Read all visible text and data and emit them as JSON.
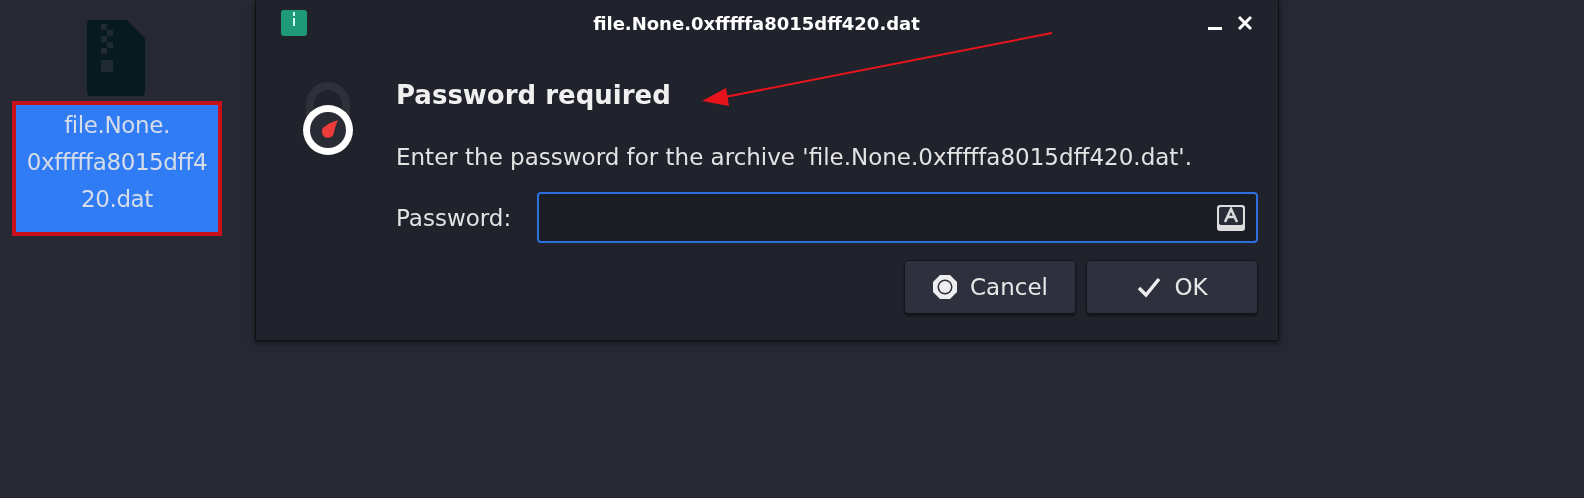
{
  "desktop_icon": {
    "label": "file.None.\n0xfffffa8015dff4\n20.dat",
    "selected": true
  },
  "window": {
    "title": "file.None.0xfffffa8015dff420.dat"
  },
  "dialog": {
    "heading": "Password required",
    "message": "Enter the password for the archive 'file.None.0xfffffa8015dff420.dat'.",
    "field_label": "Password:"
  },
  "buttons": [
    {
      "kind": "cancel",
      "label": "Cancel"
    },
    {
      "kind": "ok",
      "label": "OK"
    }
  ]
}
